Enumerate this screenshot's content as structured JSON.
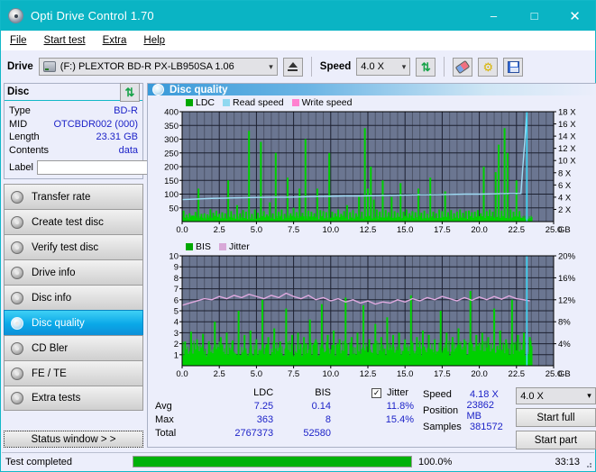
{
  "window": {
    "title": "Opti Drive Control 1.70",
    "icon": "disc-icon",
    "minimize": "–",
    "maximize": "□",
    "close": "✕",
    "titlebar_color": "#0ab4c4"
  },
  "menu": [
    {
      "label": "File"
    },
    {
      "label": "Start test"
    },
    {
      "label": "Extra"
    },
    {
      "label": "Help"
    }
  ],
  "toolbar": {
    "drive_label": "Drive",
    "drive_value": "(F:)   PLEXTOR BD-R  PX-LB950SA 1.06",
    "eject_tooltip": "Eject",
    "speed_label": "Speed",
    "speed_value": "4.0 X",
    "refresh_icon": "refresh-icon",
    "erase_icon": "eraser-icon",
    "settings_icon": "gear-icon",
    "save_icon": "floppy-disk-icon"
  },
  "disc_panel": {
    "title": "Disc",
    "refresh_icon": "refresh-icon",
    "rows": [
      {
        "key": "Type",
        "value": "BD-R"
      },
      {
        "key": "MID",
        "value": "OTCBDR002 (000)"
      },
      {
        "key": "Length",
        "value": "23.31 GB"
      },
      {
        "key": "Contents",
        "value": "data"
      }
    ],
    "label_key": "Label",
    "label_value": "",
    "label_placeholder": "",
    "disc_button_icon": "cd-icon"
  },
  "sidebar": {
    "items": [
      {
        "label": "Transfer rate",
        "icon": "disc-icon",
        "active": false
      },
      {
        "label": "Create test disc",
        "icon": "disc-icon",
        "active": false
      },
      {
        "label": "Verify test disc",
        "icon": "disc-icon",
        "active": false
      },
      {
        "label": "Drive info",
        "icon": "disc-icon",
        "active": false
      },
      {
        "label": "Disc info",
        "icon": "disc-icon",
        "active": false
      },
      {
        "label": "Disc quality",
        "icon": "disc-icon",
        "active": true
      },
      {
        "label": "CD Bler",
        "icon": "disc-icon",
        "active": false
      },
      {
        "label": "FE / TE",
        "icon": "disc-icon",
        "active": false
      },
      {
        "label": "Extra tests",
        "icon": "disc-icon",
        "active": false
      }
    ],
    "status_button": "Status window > >"
  },
  "main": {
    "title": "Disc quality",
    "icon": "disc-icon"
  },
  "stats": {
    "col_ldc": "LDC",
    "col_bis": "BIS",
    "col_jitter": "Jitter",
    "jitter_checked": true,
    "rows": [
      {
        "name": "Avg",
        "ldc": "7.25",
        "bis": "0.14",
        "jitter": "11.8%"
      },
      {
        "name": "Max",
        "ldc": "363",
        "bis": "8",
        "jitter": "15.4%"
      },
      {
        "name": "Total",
        "ldc": "2767373",
        "bis": "52580",
        "jitter": ""
      }
    ]
  },
  "readout": {
    "speed_label": "Speed",
    "speed_value": "4.18 X",
    "position_label": "Position",
    "position_value": "23862 MB",
    "samples_label": "Samples",
    "samples_value": "381572",
    "speed_select": "4.0 X",
    "start_full": "Start full",
    "start_part": "Start part"
  },
  "statusbar": {
    "message": "Test completed",
    "progress_percent": "100.0%",
    "progress_value": 100,
    "elapsed": "33:13"
  },
  "chart_data": [
    {
      "type": "area",
      "name": "top-chart",
      "title": "",
      "xlabel": "GB",
      "ylabel": "",
      "xlim": [
        0,
        25
      ],
      "ylim": [
        0,
        400
      ],
      "y2lim": [
        0,
        18
      ],
      "xticks": [
        "0.0",
        "2.5",
        "5.0",
        "7.5",
        "10.0",
        "12.5",
        "15.0",
        "17.5",
        "20.0",
        "22.5",
        "25.0"
      ],
      "yticks": [
        "50",
        "100",
        "150",
        "200",
        "250",
        "300",
        "350",
        "400"
      ],
      "y2ticks": [
        "2 X",
        "4 X",
        "6 X",
        "8 X",
        "10 X",
        "12 X",
        "14 X",
        "16 X",
        "18 X"
      ],
      "grid": true,
      "plot_bg": "#6b7691",
      "legend_position": "top-left",
      "legend": [
        {
          "name": "LDC",
          "color": "#00a800"
        },
        {
          "name": "Read speed",
          "color": "#90d8f0"
        },
        {
          "name": "Write speed",
          "color": "#ff80d0"
        }
      ],
      "series": [
        {
          "name": "LDC",
          "color": "#00d000",
          "type": "impulse",
          "x": [
            0.1,
            0.3,
            0.5,
            0.7,
            0.9,
            1.1,
            1.3,
            1.5,
            1.7,
            1.9,
            2.1,
            2.3,
            2.5,
            2.7,
            2.9,
            3.1,
            3.3,
            3.5,
            3.7,
            3.9,
            4.1,
            4.3,
            4.5,
            4.7,
            4.9,
            5.1,
            5.3,
            5.5,
            5.7,
            5.9,
            6.1,
            6.3,
            6.5,
            6.7,
            6.9,
            7.1,
            7.3,
            7.5,
            7.7,
            7.9,
            8.1,
            8.3,
            8.5,
            8.7,
            8.9,
            9.1,
            9.3,
            9.5,
            9.7,
            9.9,
            10.1,
            10.3,
            10.5,
            10.7,
            10.9,
            11.1,
            11.3,
            11.5,
            11.7,
            11.9,
            12.1,
            12.3,
            12.5,
            12.7,
            12.9,
            13.1,
            13.3,
            13.5,
            13.7,
            13.9,
            14.1,
            14.3,
            14.5,
            14.7,
            14.9,
            15.1,
            15.3,
            15.5,
            15.7,
            15.9,
            16.1,
            16.3,
            16.5,
            16.7,
            16.9,
            17.1,
            17.3,
            17.5,
            17.7,
            17.9,
            18.1,
            18.3,
            18.5,
            18.7,
            18.9,
            19.1,
            19.3,
            19.5,
            19.7,
            19.9,
            20.1,
            20.3,
            20.5,
            20.7,
            20.9,
            21.1,
            21.3,
            21.5,
            21.7,
            21.9,
            22.1,
            22.3,
            22.5,
            22.7,
            22.9,
            23.1,
            23.3,
            23.5
          ],
          "values": [
            40,
            25,
            30,
            22,
            35,
            120,
            28,
            30,
            26,
            45,
            32,
            40,
            28,
            34,
            30,
            150,
            38,
            26,
            60,
            30,
            42,
            36,
            330,
            28,
            44,
            32,
            290,
            38,
            26,
            70,
            30,
            250,
            36,
            44,
            28,
            160,
            30,
            50,
            34,
            120,
            32,
            300,
            40,
            36,
            30,
            120,
            42,
            38,
            34,
            250,
            36,
            30,
            44,
            28,
            38,
            60,
            34,
            42,
            30,
            90,
            36,
            340,
            120,
            200,
            80,
            44,
            36,
            150,
            42,
            34,
            90,
            38,
            32,
            140,
            36,
            44,
            30,
            38,
            34,
            120,
            32,
            40,
            28,
            160,
            36,
            30,
            44,
            38,
            110,
            34,
            42,
            30,
            36,
            44,
            32,
            38,
            40,
            34,
            36,
            42,
            30,
            200,
            38,
            44,
            36,
            180,
            280,
            40,
            340,
            250,
            44,
            36,
            150,
            38
          ]
        },
        {
          "name": "Read speed",
          "color": "#9fdcf5",
          "type": "line",
          "axis": "y2",
          "x": [
            0,
            1,
            2,
            3,
            4,
            5,
            6,
            7,
            8,
            9,
            10,
            11,
            12,
            13,
            14,
            15,
            16,
            17,
            18,
            19,
            20,
            21,
            22,
            22.8,
            23.2
          ],
          "values": [
            3.6,
            3.7,
            3.8,
            3.85,
            3.9,
            3.95,
            4.0,
            4.0,
            4.05,
            4.1,
            4.15,
            4.2,
            4.2,
            4.25,
            4.3,
            4.35,
            4.4,
            4.4,
            4.45,
            4.5,
            4.5,
            4.55,
            4.6,
            4.6,
            18
          ]
        }
      ]
    },
    {
      "type": "area",
      "name": "bottom-chart",
      "title": "",
      "xlabel": "GB",
      "ylabel": "",
      "xlim": [
        0,
        25
      ],
      "ylim": [
        0,
        10
      ],
      "y2lim": [
        0,
        20
      ],
      "xticks": [
        "0.0",
        "2.5",
        "5.0",
        "7.5",
        "10.0",
        "12.5",
        "15.0",
        "17.5",
        "20.0",
        "22.5",
        "25.0"
      ],
      "yticks": [
        "1",
        "2",
        "3",
        "4",
        "5",
        "6",
        "7",
        "8",
        "9",
        "10"
      ],
      "y2ticks": [
        "4%",
        "8%",
        "12%",
        "16%",
        "20%"
      ],
      "grid": true,
      "plot_bg": "#6b7691",
      "legend_position": "top-left",
      "legend": [
        {
          "name": "BIS",
          "color": "#00a800"
        },
        {
          "name": "Jitter",
          "color": "#d8a8d8"
        }
      ],
      "series": [
        {
          "name": "BIS",
          "color": "#00d000",
          "type": "impulse",
          "base": 1.9,
          "x": [
            0.2,
            0.6,
            1.0,
            1.4,
            1.8,
            2.2,
            2.6,
            3.0,
            3.4,
            3.8,
            4.2,
            4.6,
            5.0,
            5.4,
            5.8,
            6.2,
            6.6,
            7.0,
            7.4,
            7.8,
            8.2,
            8.6,
            9.0,
            9.4,
            9.8,
            10.2,
            10.6,
            11.0,
            11.4,
            11.8,
            12.2,
            12.6,
            13.0,
            13.4,
            13.8,
            14.2,
            14.6,
            15.0,
            15.4,
            15.8,
            16.2,
            16.6,
            17.0,
            17.4,
            17.8,
            18.2,
            18.6,
            19.0,
            19.4,
            19.8,
            20.2,
            20.6,
            21.0,
            21.4,
            21.8,
            22.2,
            22.6,
            23.0,
            23.4
          ],
          "values": [
            2.2,
            3.1,
            2.4,
            2.9,
            2.2,
            4.0,
            2.6,
            3.0,
            2.3,
            5.0,
            2.8,
            3.2,
            2.4,
            6.0,
            2.6,
            3.4,
            2.2,
            5.2,
            2.8,
            3.0,
            2.6,
            4.2,
            2.4,
            5.6,
            2.8,
            3.2,
            2.4,
            6.2,
            2.6,
            3.0,
            5.5,
            2.4,
            3.8,
            2.6,
            4.4,
            2.8,
            3.0,
            2.4,
            6.4,
            2.6,
            3.2,
            2.8,
            2.4,
            5.0,
            3.0,
            2.6,
            3.4,
            2.4,
            6.8,
            2.8,
            3.0,
            2.6,
            5.2,
            3.2,
            2.4,
            6.0,
            2.8,
            3.0,
            2.6
          ]
        },
        {
          "name": "Jitter",
          "color": "#e0aae0",
          "type": "line",
          "axis": "y2",
          "x": [
            0,
            0.5,
            1,
            1.5,
            2,
            2.5,
            3,
            3.5,
            4,
            4.5,
            5,
            5.5,
            6,
            6.5,
            7,
            7.5,
            8,
            8.5,
            9,
            9.5,
            10,
            10.5,
            11,
            11.5,
            12,
            12.5,
            13,
            13.5,
            14,
            14.5,
            15,
            15.5,
            16,
            16.5,
            17,
            17.5,
            18,
            18.5,
            19,
            19.5,
            20,
            20.5,
            21,
            21.5,
            22,
            22.5,
            23,
            23.4
          ],
          "values": [
            11.0,
            11.4,
            11.8,
            12.2,
            12.0,
            12.6,
            12.2,
            12.8,
            12.4,
            13.0,
            12.6,
            12.2,
            12.8,
            12.4,
            13.2,
            12.6,
            12.2,
            12.8,
            12.0,
            12.4,
            11.8,
            12.2,
            11.6,
            12.0,
            11.4,
            11.8,
            11.2,
            11.6,
            11.4,
            12.0,
            11.6,
            12.2,
            11.8,
            12.4,
            12.0,
            12.6,
            12.2,
            11.8,
            12.4,
            11.9,
            12.5,
            12.0,
            12.6,
            12.1,
            12.7,
            12.2,
            12.0,
            11.8
          ]
        }
      ]
    }
  ]
}
